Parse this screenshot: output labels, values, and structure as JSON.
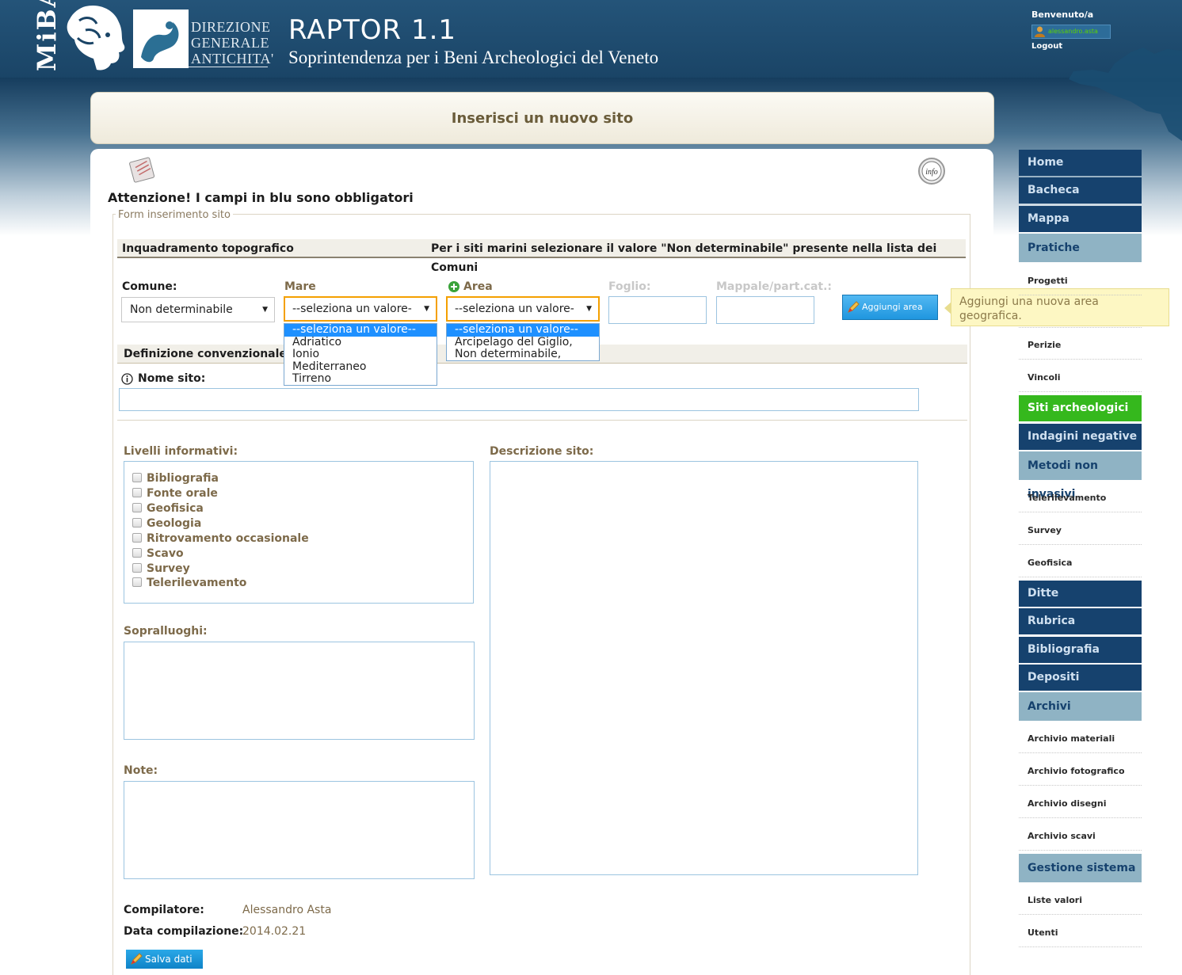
{
  "header": {
    "logo_text": "MiBAC",
    "dg_lines": [
      "DIREZIONE",
      "GENERALE",
      "ANTICHITA'"
    ],
    "app_title": "RAPTOR 1.1",
    "app_subtitle": "Soprintendenza per i Beni Archeologici del Veneto",
    "welcome": "Benvenuto/a",
    "user": "alessandro.asta",
    "logout": "Logout"
  },
  "page_title": "Inserisci un nuovo sito",
  "warning": "Attenzione! I campi in blu sono obbligatori",
  "form": {
    "legend": "Form inserimento sito",
    "section_topo": "Inquadramento topografico",
    "section_topo_note": "Per i siti marini selezionare il valore \"Non determinabile\" presente nella lista dei Comuni",
    "comune_label": "Comune:",
    "comune_value": "Non determinabile",
    "mare_label": "Mare",
    "mare_value": "--seleziona un valore-",
    "mare_options": [
      "--seleziona un valore--",
      "Adriatico",
      "Ionio",
      "Mediterraneo",
      "Tirreno"
    ],
    "area_label": "Area",
    "area_value": "--seleziona un valore-",
    "area_options": [
      "--seleziona un valore--",
      "Arcipelago del Giglio,",
      "Non determinabile,"
    ],
    "foglio_label": "Foglio:",
    "mappale_label": "Mappale/part.cat.:",
    "add_area_button": "Aggiungi area",
    "add_area_tooltip": "Aggiungi una nuova area geografica.",
    "section_def": "Definizione convenzionale",
    "nome_sito_label": "Nome sito:",
    "livelli_label": "Livelli informativi:",
    "livelli": [
      "Bibliografia",
      "Fonte orale",
      "Geofisica",
      "Geologia",
      "Ritrovamento occasionale",
      "Scavo",
      "Survey",
      "Telerilevamento"
    ],
    "descrizione_label": "Descrizione sito:",
    "sopralluoghi_label": "Sopralluoghi:",
    "note_label": "Note:",
    "compilatore_label": "Compilatore:",
    "compilatore_value": "Alessandro Asta",
    "data_label": "Data compilazione:",
    "data_value": "2014.02.21",
    "save_button": "Salva dati"
  },
  "menu": {
    "home": "Home",
    "bacheca": "Bacheca",
    "mappa": "Mappa",
    "pratiche": "Pratiche",
    "progetti": "Progetti",
    "perizie": "Perizie",
    "vincoli": "Vincoli",
    "siti": "Siti archeologici",
    "indagini": "Indagini negative",
    "metodi": "Metodi non invasivi",
    "telerilevamento": "Telerilevamento",
    "survey": "Survey",
    "geofisica": "Geofisica",
    "ditte": "Ditte",
    "rubrica": "Rubrica",
    "bibliografia": "Bibliografia",
    "depositi": "Depositi",
    "archivi": "Archivi",
    "archivio_materiali": "Archivio materiali",
    "archivio_fotografico": "Archivio fotografico",
    "archivio_disegni": "Archivio disegni",
    "archivio_scavi": "Archivio scavi",
    "gestione": "Gestione sistema",
    "liste_valori": "Liste valori",
    "utenti": "Utenti"
  },
  "colors": {
    "header": "#1a4466",
    "menu_dark": "#16426e",
    "menu_light": "#8fb3c4",
    "menu_active": "#35b81d",
    "accent_button": "#1f96df"
  }
}
